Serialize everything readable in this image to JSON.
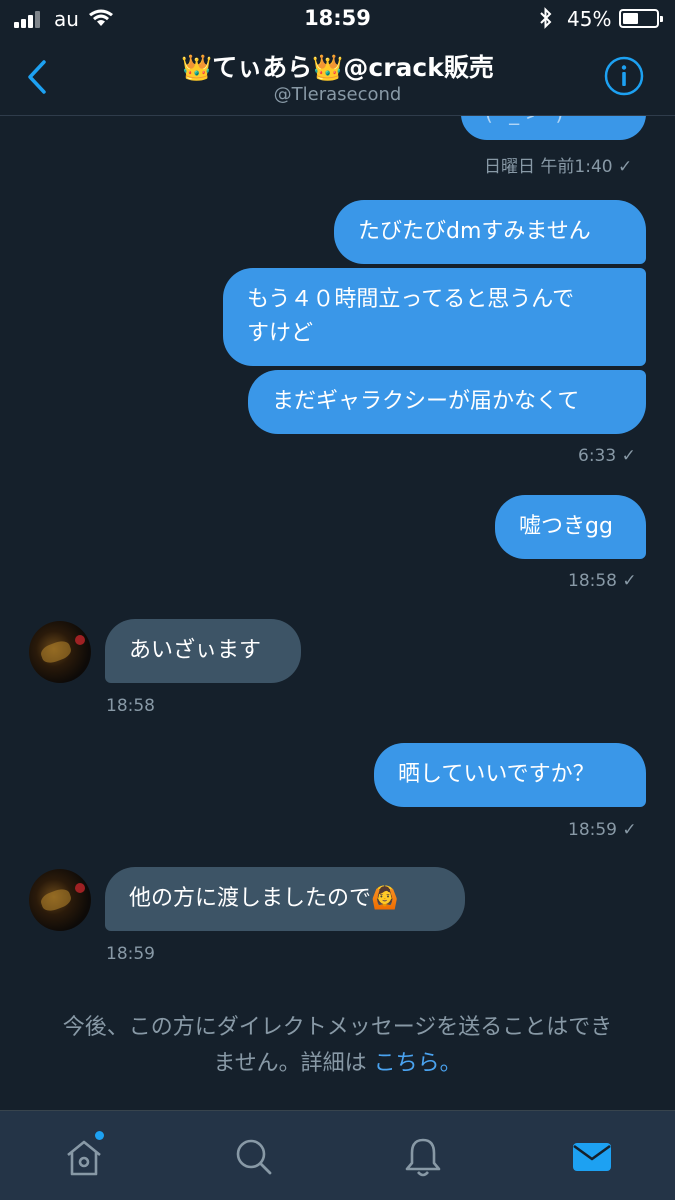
{
  "status_bar": {
    "carrier": "au",
    "time": "18:59",
    "battery": "45%",
    "battery_level": 0.45
  },
  "header": {
    "title": "👑てぃあら👑@crack販売",
    "handle": "@Tlerasecond"
  },
  "messages": {
    "top_bubble_fragment": "( ´_ゝ` )",
    "top_ts": "日曜日 午前1:40 ✓",
    "m1": "たびたびdmすみません",
    "m2a": "もう４０時間立ってると思うんで",
    "m2b": "すけど",
    "m3": "まだギャラクシーが届かなくて",
    "ts1": "6:33 ✓",
    "m4": "嘘つきgg",
    "ts2": "18:58 ✓",
    "r1": "あいざぃます",
    "rts1": "18:58",
    "m5": "晒していいですか？",
    "ts3": "18:59 ✓",
    "r2": "他の方に渡しましたので🙆",
    "rts2": "18:59"
  },
  "notice": {
    "line1": "今後、この方にダイレクトメッセージを送ることはでき",
    "line2": "ません。詳細は",
    "link": "こちら。"
  },
  "tabs": [
    "home-icon",
    "search-icon",
    "notifications-icon",
    "messages-icon"
  ],
  "colors": {
    "accent": "#1da1f2",
    "background": "#15202b",
    "outgoing": "#3a97e8",
    "incoming": "#3d5466",
    "muted": "#8899a6"
  }
}
